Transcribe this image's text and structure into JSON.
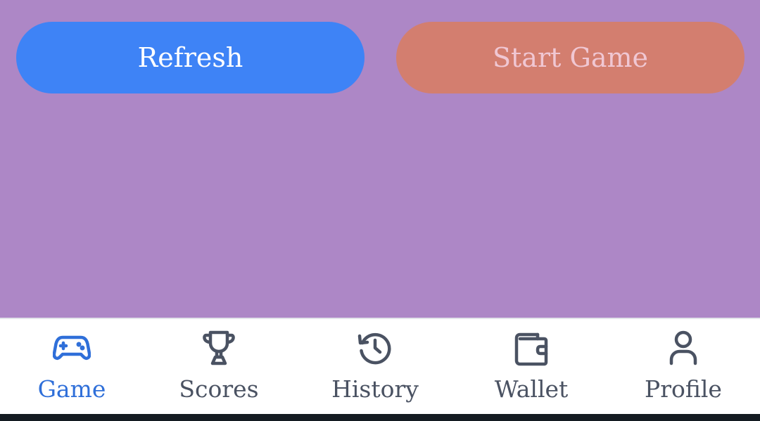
{
  "colors": {
    "background": "#ad87c6",
    "refresh_button": "#3e83f6",
    "start_button": "#d37e6f",
    "start_button_text": "#f0c7d3",
    "nav_active": "#2f6fd9",
    "nav_inactive": "#4a5262"
  },
  "actions": {
    "refresh_label": "Refresh",
    "start_game_label": "Start Game"
  },
  "nav": {
    "active": "Game",
    "items": [
      {
        "label": "Game",
        "icon": "gamepad-icon"
      },
      {
        "label": "Scores",
        "icon": "trophy-icon"
      },
      {
        "label": "History",
        "icon": "history-icon"
      },
      {
        "label": "Wallet",
        "icon": "wallet-icon"
      },
      {
        "label": "Profile",
        "icon": "user-icon"
      }
    ]
  }
}
